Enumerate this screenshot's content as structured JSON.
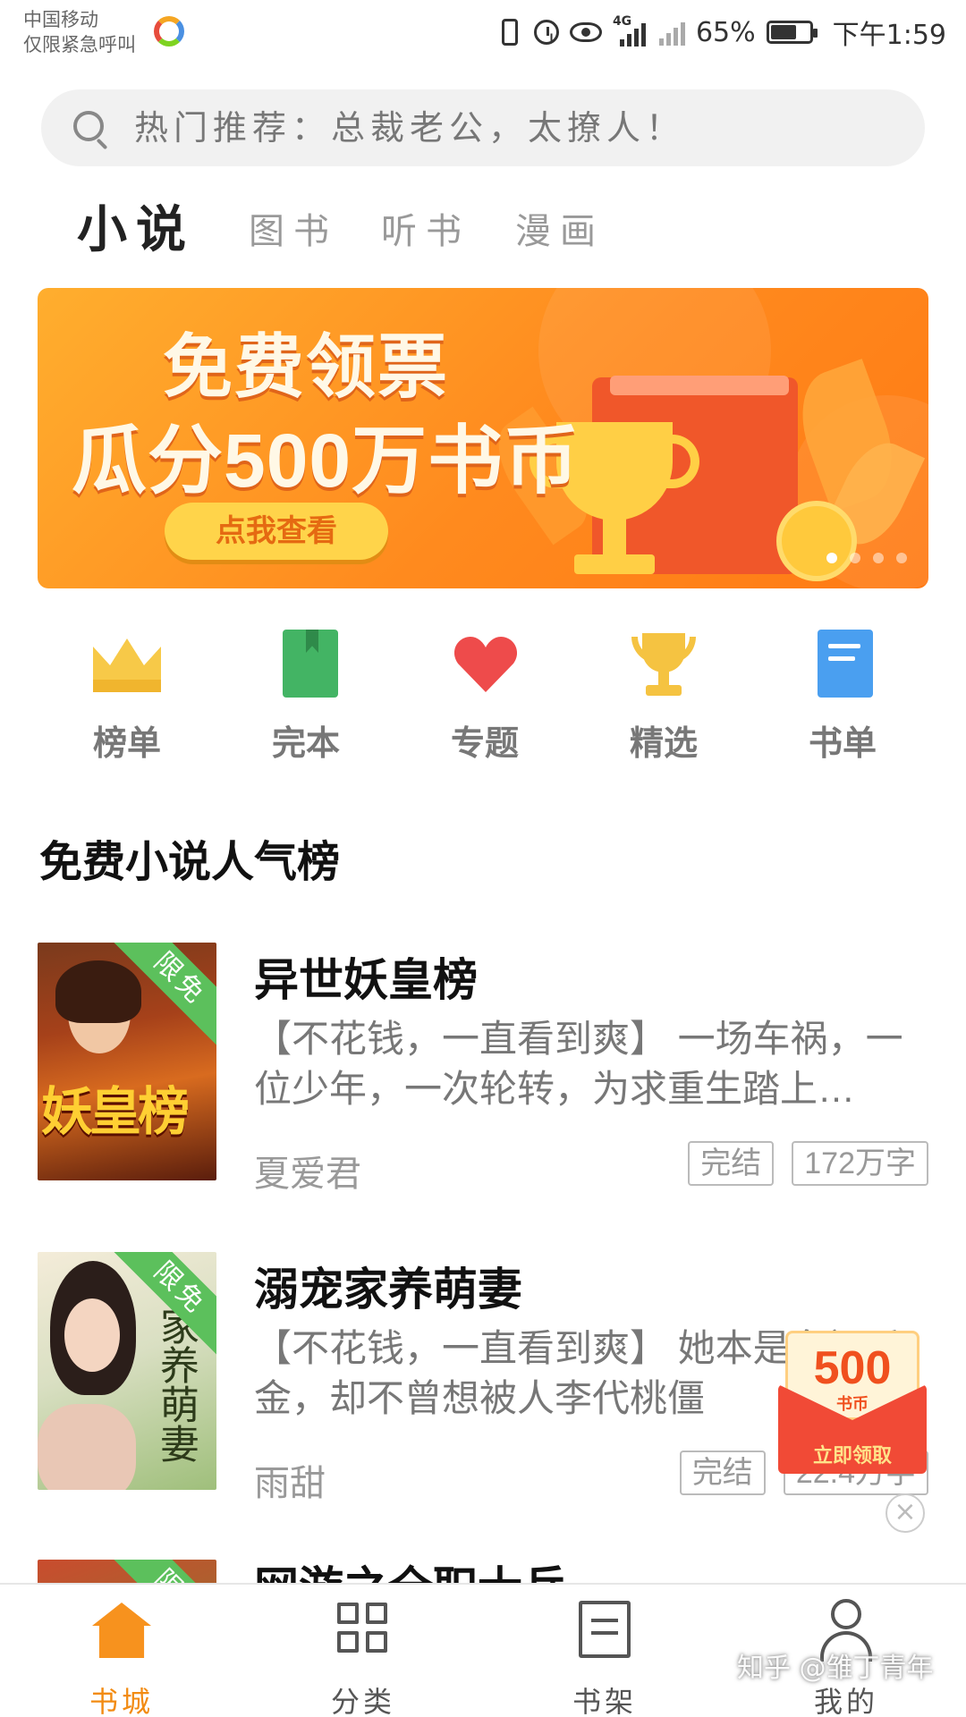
{
  "status_bar": {
    "carrier_line1": "中国移动",
    "carrier_line2": "仅限紧急呼叫",
    "network": "4G",
    "battery": "65%",
    "time": "下午1:59"
  },
  "search": {
    "placeholder": "热门推荐：总裁老公，太撩人！"
  },
  "tabs": [
    {
      "label": "小说",
      "active": true
    },
    {
      "label": "图书",
      "active": false
    },
    {
      "label": "听书",
      "active": false
    },
    {
      "label": "漫画",
      "active": false
    }
  ],
  "banner": {
    "line1": "免费领票",
    "line2": "瓜分500万书币",
    "button": "点我查看",
    "page_count": 4,
    "active_page": 1
  },
  "categories": [
    {
      "label": "榜单",
      "icon": "crown-icon"
    },
    {
      "label": "完本",
      "icon": "book-icon"
    },
    {
      "label": "专题",
      "icon": "heart-icon"
    },
    {
      "label": "精选",
      "icon": "trophy-icon"
    },
    {
      "label": "书单",
      "icon": "booklist-icon"
    }
  ],
  "section": {
    "title": "免费小说人气榜"
  },
  "books": [
    {
      "title": "异世妖皇榜",
      "desc": "【不花钱，一直看到爽】 一场车祸，一位少年，一次轮转，为求重生踏上…",
      "author": "夏爱君",
      "status": "完结",
      "words": "172万字",
      "badge": "限免",
      "cover_text": "妖皇榜"
    },
    {
      "title": "溺宠家养萌妻",
      "desc": "【不花钱，一直看到爽】 她本是名门千金，却不曾想被人李代桃僵",
      "author": "雨甜",
      "status": "完结",
      "words": "22.4万字",
      "badge": "限免",
      "cover_text": "家养萌妻"
    },
    {
      "title": "网游之全职士兵",
      "badge": "限免"
    }
  ],
  "envelope": {
    "amount": "500",
    "unit": "书币",
    "action": "立即领取",
    "close": "×"
  },
  "bottom_nav": [
    {
      "label": "书城",
      "active": true
    },
    {
      "label": "分类",
      "active": false
    },
    {
      "label": "书架",
      "active": false
    },
    {
      "label": "我的",
      "active": false
    }
  ],
  "watermark": "知乎 @雏丁青年",
  "colors": {
    "accent": "#f7921e",
    "banner": "#ff8a1e",
    "ribbon": "#5cc05c",
    "envelope": "#f14a36"
  }
}
